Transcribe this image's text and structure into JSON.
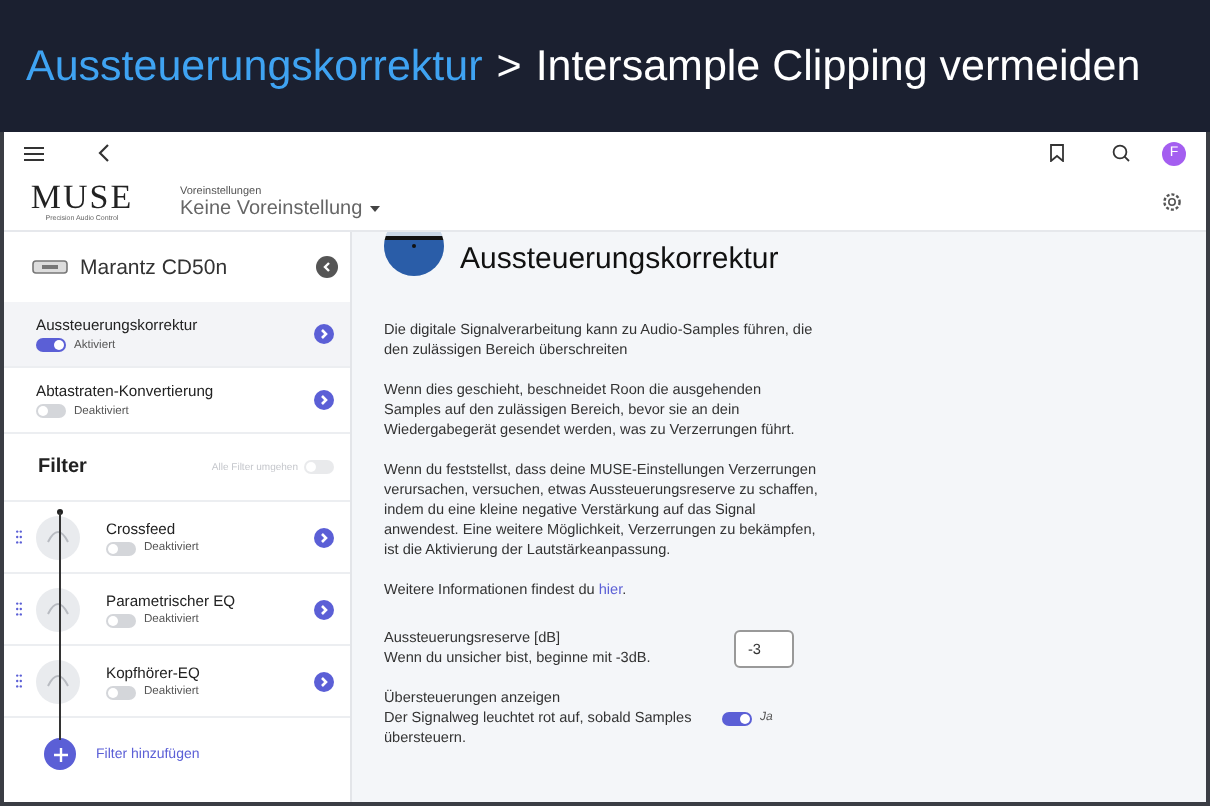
{
  "banner": {
    "section": "Aussteuerungskorrektur",
    "separator": ">",
    "page": "Intersample Clipping vermeiden"
  },
  "toolbar": {
    "avatar": "F"
  },
  "header": {
    "logo": "MUSE",
    "logo_tagline": "Precision Audio Control",
    "presets_label": "Voreinstellungen",
    "preset": "Keine Voreinstellung"
  },
  "sidebar": {
    "device": "Marantz CD50n",
    "items": [
      {
        "label": "Aussteuerungskorrektur",
        "status": "Aktiviert",
        "on": true,
        "selected": true
      },
      {
        "label": "Abtastraten-Konvertierung",
        "status": "Deaktiviert",
        "on": false,
        "selected": false
      }
    ],
    "filter_title": "Filter",
    "bypass_all": {
      "label": "Alle Filter umgehen",
      "on": false,
      "disabled": true
    },
    "filters": [
      {
        "label": "Crossfeed",
        "status": "Deaktiviert",
        "on": false
      },
      {
        "label": "Parametrischer EQ",
        "status": "Deaktiviert",
        "on": false
      },
      {
        "label": "Kopfhörer-EQ",
        "status": "Deaktiviert",
        "on": false
      }
    ],
    "add_filter": "Filter hinzufügen"
  },
  "content": {
    "title": "Aussteuerungskorrektur",
    "paragraphs": [
      "Die digitale Signalverarbeitung kann zu Audio-Samples führen, die den zulässigen Bereich überschreiten",
      "Wenn dies geschieht, beschneidet Roon die ausgehenden Samples auf den zulässigen Bereich, bevor sie an dein Wiedergabegerät gesendet werden, was zu Verzerrungen führt.",
      "Wenn du feststellst, dass deine MUSE-Einstellungen Verzerrungen verursachen, versuchen, etwas Aussteuerungsreserve zu schaffen, indem du eine kleine negative Verstärkung auf das Signal anwendest. Eine weitere Möglichkeit, Verzerrungen zu bekämpfen, ist die Aktivierung der Lautstärkeanpassung."
    ],
    "more_info": {
      "text": "Weitere Informationen findest du ",
      "link": "hier",
      "end": "."
    },
    "headroom": {
      "label": "Aussteuerungsreserve [dB]",
      "hint": "Wenn du unsicher bist, beginne mit -3dB.",
      "value": "-3"
    },
    "clipping": {
      "label": "Übersteuerungen anzeigen",
      "hint": "Der Signalweg leuchtet rot auf, sobald Samples übersteuern.",
      "on": true,
      "state_label": "Ja"
    }
  }
}
